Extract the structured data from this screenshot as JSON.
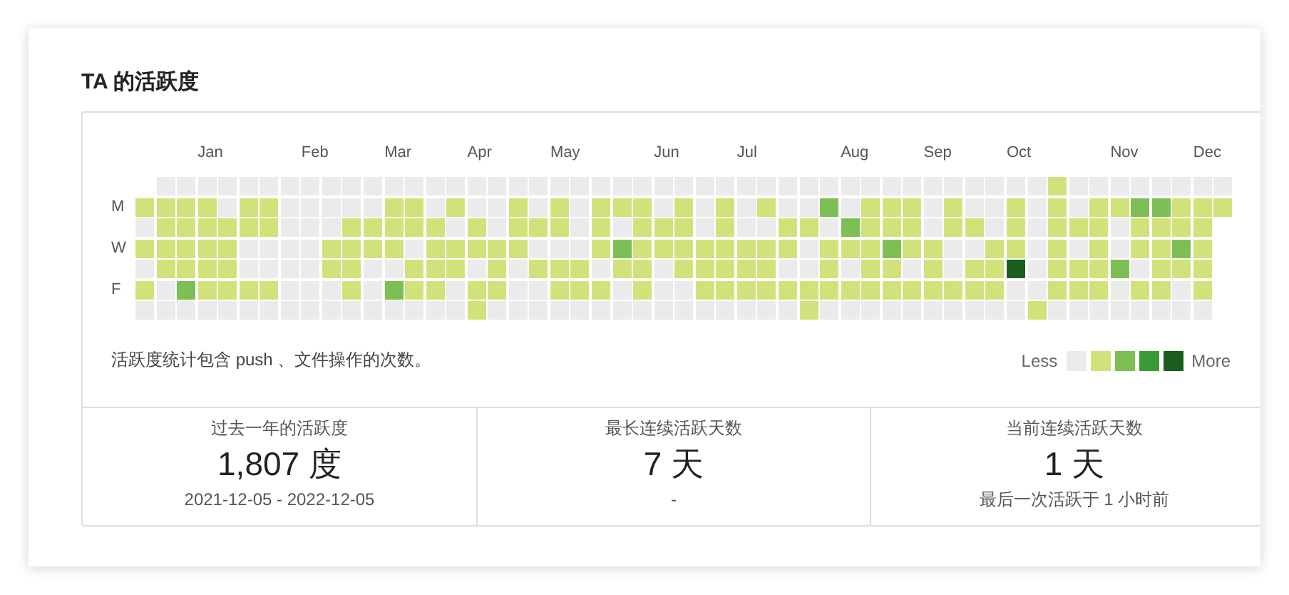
{
  "title": "TA 的活跃度",
  "day_labels": [
    "M",
    "W",
    "F"
  ],
  "weeks": [
    {
      "days": [
        {
          "color": "#d2e27a"
        },
        {
          "color": "#ebebeb"
        },
        {
          "color": "#d2e27a"
        },
        {
          "color": "#ebebeb"
        },
        {
          "color": "#d2e27a"
        },
        {
          "color": "#ebebeb"
        }
      ]
    },
    {
      "days": [
        {
          "color": "#ebebeb"
        },
        {
          "color": "#d2e27a"
        },
        {
          "color": "#d2e27a"
        },
        {
          "color": "#d2e27a"
        },
        {
          "color": "#d2e27a"
        },
        {
          "color": "#ebebeb"
        },
        {
          "color": "#ebebeb"
        }
      ]
    },
    {
      "days": [
        {
          "color": "#ebebeb"
        },
        {
          "color": "#d2e27a"
        },
        {
          "color": "#d2e27a"
        },
        {
          "color": "#d2e27a"
        },
        {
          "color": "#d2e27a"
        },
        {
          "color": "#7dbf55"
        },
        {
          "color": "#ebebeb"
        }
      ]
    },
    {
      "month": "Jan",
      "days": [
        {
          "color": "#ebebeb"
        },
        {
          "color": "#d2e27a"
        },
        {
          "color": "#d2e27a"
        },
        {
          "color": "#d2e27a"
        },
        {
          "color": "#d2e27a"
        },
        {
          "color": "#d2e27a"
        },
        {
          "color": "#ebebeb"
        }
      ]
    },
    {
      "days": [
        {
          "color": "#ebebeb"
        },
        {
          "color": "#ebebeb"
        },
        {
          "color": "#d2e27a"
        },
        {
          "color": "#d2e27a"
        },
        {
          "color": "#d2e27a"
        },
        {
          "color": "#d2e27a"
        },
        {
          "color": "#ebebeb"
        }
      ]
    },
    {
      "days": [
        {
          "color": "#ebebeb"
        },
        {
          "color": "#d2e27a"
        },
        {
          "color": "#d2e27a"
        },
        {
          "color": "#ebebeb"
        },
        {
          "color": "#ebebeb"
        },
        {
          "color": "#d2e27a"
        },
        {
          "color": "#ebebeb"
        }
      ]
    },
    {
      "days": [
        {
          "color": "#ebebeb"
        },
        {
          "color": "#d2e27a"
        },
        {
          "color": "#d2e27a"
        },
        {
          "color": "#ebebeb"
        },
        {
          "color": "#ebebeb"
        },
        {
          "color": "#d2e27a"
        },
        {
          "color": "#ebebeb"
        }
      ]
    },
    {
      "days": [
        {
          "color": "#ebebeb"
        },
        {
          "color": "#ebebeb"
        },
        {
          "color": "#ebebeb"
        },
        {
          "color": "#ebebeb"
        },
        {
          "color": "#ebebeb"
        },
        {
          "color": "#ebebeb"
        },
        {
          "color": "#ebebeb"
        }
      ]
    },
    {
      "month": "Feb",
      "days": [
        {
          "color": "#ebebeb"
        },
        {
          "color": "#ebebeb"
        },
        {
          "color": "#ebebeb"
        },
        {
          "color": "#ebebeb"
        },
        {
          "color": "#ebebeb"
        },
        {
          "color": "#ebebeb"
        },
        {
          "color": "#ebebeb"
        }
      ]
    },
    {
      "days": [
        {
          "color": "#ebebeb"
        },
        {
          "color": "#ebebeb"
        },
        {
          "color": "#ebebeb"
        },
        {
          "color": "#d2e27a"
        },
        {
          "color": "#d2e27a"
        },
        {
          "color": "#ebebeb"
        },
        {
          "color": "#ebebeb"
        }
      ]
    },
    {
      "days": [
        {
          "color": "#ebebeb"
        },
        {
          "color": "#ebebeb"
        },
        {
          "color": "#d2e27a"
        },
        {
          "color": "#d2e27a"
        },
        {
          "color": "#d2e27a"
        },
        {
          "color": "#d2e27a"
        },
        {
          "color": "#ebebeb"
        }
      ]
    },
    {
      "days": [
        {
          "color": "#ebebeb"
        },
        {
          "color": "#ebebeb"
        },
        {
          "color": "#d2e27a"
        },
        {
          "color": "#d2e27a"
        },
        {
          "color": "#ebebeb"
        },
        {
          "color": "#ebebeb"
        },
        {
          "color": "#ebebeb"
        }
      ]
    },
    {
      "month": "Mar",
      "days": [
        {
          "color": "#ebebeb"
        },
        {
          "color": "#d2e27a"
        },
        {
          "color": "#d2e27a"
        },
        {
          "color": "#d2e27a"
        },
        {
          "color": "#ebebeb"
        },
        {
          "color": "#7dbf55"
        },
        {
          "color": "#ebebeb"
        }
      ]
    },
    {
      "days": [
        {
          "color": "#ebebeb"
        },
        {
          "color": "#d2e27a"
        },
        {
          "color": "#d2e27a"
        },
        {
          "color": "#ebebeb"
        },
        {
          "color": "#d2e27a"
        },
        {
          "color": "#d2e27a"
        },
        {
          "color": "#ebebeb"
        }
      ]
    },
    {
      "days": [
        {
          "color": "#ebebeb"
        },
        {
          "color": "#ebebeb"
        },
        {
          "color": "#d2e27a"
        },
        {
          "color": "#d2e27a"
        },
        {
          "color": "#d2e27a"
        },
        {
          "color": "#d2e27a"
        },
        {
          "color": "#ebebeb"
        }
      ]
    },
    {
      "days": [
        {
          "color": "#ebebeb"
        },
        {
          "color": "#d2e27a"
        },
        {
          "color": "#ebebeb"
        },
        {
          "color": "#d2e27a"
        },
        {
          "color": "#d2e27a"
        },
        {
          "color": "#ebebeb"
        },
        {
          "color": "#ebebeb"
        }
      ]
    },
    {
      "month": "Apr",
      "days": [
        {
          "color": "#ebebeb"
        },
        {
          "color": "#ebebeb"
        },
        {
          "color": "#d2e27a"
        },
        {
          "color": "#d2e27a"
        },
        {
          "color": "#ebebeb"
        },
        {
          "color": "#d2e27a"
        },
        {
          "color": "#d2e27a"
        }
      ]
    },
    {
      "days": [
        {
          "color": "#ebebeb"
        },
        {
          "color": "#ebebeb"
        },
        {
          "color": "#ebebeb"
        },
        {
          "color": "#d2e27a"
        },
        {
          "color": "#d2e27a"
        },
        {
          "color": "#d2e27a"
        },
        {
          "color": "#ebebeb"
        }
      ]
    },
    {
      "days": [
        {
          "color": "#ebebeb"
        },
        {
          "color": "#d2e27a"
        },
        {
          "color": "#d2e27a"
        },
        {
          "color": "#d2e27a"
        },
        {
          "color": "#ebebeb"
        },
        {
          "color": "#ebebeb"
        },
        {
          "color": "#ebebeb"
        }
      ]
    },
    {
      "days": [
        {
          "color": "#ebebeb"
        },
        {
          "color": "#ebebeb"
        },
        {
          "color": "#d2e27a"
        },
        {
          "color": "#ebebeb"
        },
        {
          "color": "#d2e27a"
        },
        {
          "color": "#ebebeb"
        },
        {
          "color": "#ebebeb"
        }
      ]
    },
    {
      "month": "May",
      "days": [
        {
          "color": "#ebebeb"
        },
        {
          "color": "#d2e27a"
        },
        {
          "color": "#d2e27a"
        },
        {
          "color": "#ebebeb"
        },
        {
          "color": "#d2e27a"
        },
        {
          "color": "#d2e27a"
        },
        {
          "color": "#ebebeb"
        }
      ]
    },
    {
      "days": [
        {
          "color": "#ebebeb"
        },
        {
          "color": "#ebebeb"
        },
        {
          "color": "#ebebeb"
        },
        {
          "color": "#ebebeb"
        },
        {
          "color": "#d2e27a"
        },
        {
          "color": "#d2e27a"
        },
        {
          "color": "#ebebeb"
        }
      ]
    },
    {
      "days": [
        {
          "color": "#ebebeb"
        },
        {
          "color": "#d2e27a"
        },
        {
          "color": "#d2e27a"
        },
        {
          "color": "#d2e27a"
        },
        {
          "color": "#ebebeb"
        },
        {
          "color": "#d2e27a"
        },
        {
          "color": "#ebebeb"
        }
      ]
    },
    {
      "days": [
        {
          "color": "#ebebeb"
        },
        {
          "color": "#d2e27a"
        },
        {
          "color": "#ebebeb"
        },
        {
          "color": "#7dbf55"
        },
        {
          "color": "#d2e27a"
        },
        {
          "color": "#ebebeb"
        },
        {
          "color": "#ebebeb"
        }
      ]
    },
    {
      "days": [
        {
          "color": "#ebebeb"
        },
        {
          "color": "#d2e27a"
        },
        {
          "color": "#d2e27a"
        },
        {
          "color": "#d2e27a"
        },
        {
          "color": "#d2e27a"
        },
        {
          "color": "#d2e27a"
        },
        {
          "color": "#ebebeb"
        }
      ]
    },
    {
      "month": "Jun",
      "days": [
        {
          "color": "#ebebeb"
        },
        {
          "color": "#ebebeb"
        },
        {
          "color": "#d2e27a"
        },
        {
          "color": "#d2e27a"
        },
        {
          "color": "#ebebeb"
        },
        {
          "color": "#ebebeb"
        },
        {
          "color": "#ebebeb"
        }
      ]
    },
    {
      "days": [
        {
          "color": "#ebebeb"
        },
        {
          "color": "#d2e27a"
        },
        {
          "color": "#d2e27a"
        },
        {
          "color": "#d2e27a"
        },
        {
          "color": "#d2e27a"
        },
        {
          "color": "#ebebeb"
        },
        {
          "color": "#ebebeb"
        }
      ]
    },
    {
      "days": [
        {
          "color": "#ebebeb"
        },
        {
          "color": "#ebebeb"
        },
        {
          "color": "#ebebeb"
        },
        {
          "color": "#d2e27a"
        },
        {
          "color": "#d2e27a"
        },
        {
          "color": "#d2e27a"
        },
        {
          "color": "#ebebeb"
        }
      ]
    },
    {
      "days": [
        {
          "color": "#ebebeb"
        },
        {
          "color": "#d2e27a"
        },
        {
          "color": "#d2e27a"
        },
        {
          "color": "#d2e27a"
        },
        {
          "color": "#d2e27a"
        },
        {
          "color": "#d2e27a"
        },
        {
          "color": "#ebebeb"
        }
      ]
    },
    {
      "month": "Jul",
      "days": [
        {
          "color": "#ebebeb"
        },
        {
          "color": "#ebebeb"
        },
        {
          "color": "#ebebeb"
        },
        {
          "color": "#d2e27a"
        },
        {
          "color": "#d2e27a"
        },
        {
          "color": "#d2e27a"
        },
        {
          "color": "#ebebeb"
        }
      ]
    },
    {
      "days": [
        {
          "color": "#ebebeb"
        },
        {
          "color": "#d2e27a"
        },
        {
          "color": "#ebebeb"
        },
        {
          "color": "#d2e27a"
        },
        {
          "color": "#d2e27a"
        },
        {
          "color": "#d2e27a"
        },
        {
          "color": "#ebebeb"
        }
      ]
    },
    {
      "days": [
        {
          "color": "#ebebeb"
        },
        {
          "color": "#ebebeb"
        },
        {
          "color": "#d2e27a"
        },
        {
          "color": "#d2e27a"
        },
        {
          "color": "#ebebeb"
        },
        {
          "color": "#d2e27a"
        },
        {
          "color": "#ebebeb"
        }
      ]
    },
    {
      "days": [
        {
          "color": "#ebebeb"
        },
        {
          "color": "#ebebeb"
        },
        {
          "color": "#d2e27a"
        },
        {
          "color": "#ebebeb"
        },
        {
          "color": "#ebebeb"
        },
        {
          "color": "#d2e27a"
        },
        {
          "color": "#d2e27a"
        }
      ]
    },
    {
      "days": [
        {
          "color": "#ebebeb"
        },
        {
          "color": "#7dbf55"
        },
        {
          "color": "#ebebeb"
        },
        {
          "color": "#d2e27a"
        },
        {
          "color": "#d2e27a"
        },
        {
          "color": "#d2e27a"
        },
        {
          "color": "#ebebeb"
        }
      ]
    },
    {
      "month": "Aug",
      "days": [
        {
          "color": "#ebebeb"
        },
        {
          "color": "#ebebeb"
        },
        {
          "color": "#7dbf55"
        },
        {
          "color": "#d2e27a"
        },
        {
          "color": "#ebebeb"
        },
        {
          "color": "#d2e27a"
        },
        {
          "color": "#ebebeb"
        }
      ]
    },
    {
      "days": [
        {
          "color": "#ebebeb"
        },
        {
          "color": "#d2e27a"
        },
        {
          "color": "#d2e27a"
        },
        {
          "color": "#d2e27a"
        },
        {
          "color": "#d2e27a"
        },
        {
          "color": "#d2e27a"
        },
        {
          "color": "#ebebeb"
        }
      ]
    },
    {
      "days": [
        {
          "color": "#ebebeb"
        },
        {
          "color": "#d2e27a"
        },
        {
          "color": "#d2e27a"
        },
        {
          "color": "#7dbf55"
        },
        {
          "color": "#d2e27a"
        },
        {
          "color": "#d2e27a"
        },
        {
          "color": "#ebebeb"
        }
      ]
    },
    {
      "days": [
        {
          "color": "#ebebeb"
        },
        {
          "color": "#d2e27a"
        },
        {
          "color": "#d2e27a"
        },
        {
          "color": "#d2e27a"
        },
        {
          "color": "#ebebeb"
        },
        {
          "color": "#d2e27a"
        },
        {
          "color": "#ebebeb"
        }
      ]
    },
    {
      "month": "Sep",
      "days": [
        {
          "color": "#ebebeb"
        },
        {
          "color": "#ebebeb"
        },
        {
          "color": "#ebebeb"
        },
        {
          "color": "#d2e27a"
        },
        {
          "color": "#d2e27a"
        },
        {
          "color": "#d2e27a"
        },
        {
          "color": "#ebebeb"
        }
      ]
    },
    {
      "days": [
        {
          "color": "#ebebeb"
        },
        {
          "color": "#d2e27a"
        },
        {
          "color": "#d2e27a"
        },
        {
          "color": "#ebebeb"
        },
        {
          "color": "#ebebeb"
        },
        {
          "color": "#d2e27a"
        },
        {
          "color": "#ebebeb"
        }
      ]
    },
    {
      "days": [
        {
          "color": "#ebebeb"
        },
        {
          "color": "#ebebeb"
        },
        {
          "color": "#d2e27a"
        },
        {
          "color": "#ebebeb"
        },
        {
          "color": "#d2e27a"
        },
        {
          "color": "#d2e27a"
        },
        {
          "color": "#ebebeb"
        }
      ]
    },
    {
      "days": [
        {
          "color": "#ebebeb"
        },
        {
          "color": "#ebebeb"
        },
        {
          "color": "#ebebeb"
        },
        {
          "color": "#d2e27a"
        },
        {
          "color": "#d2e27a"
        },
        {
          "color": "#d2e27a"
        },
        {
          "color": "#ebebeb"
        }
      ]
    },
    {
      "month": "Oct",
      "days": [
        {
          "color": "#ebebeb"
        },
        {
          "color": "#d2e27a"
        },
        {
          "color": "#d2e27a"
        },
        {
          "color": "#d2e27a"
        },
        {
          "color": "#1b5e20"
        },
        {
          "color": "#ebebeb"
        },
        {
          "color": "#ebebeb"
        }
      ]
    },
    {
      "days": [
        {
          "color": "#ebebeb"
        },
        {
          "color": "#ebebeb"
        },
        {
          "color": "#ebebeb"
        },
        {
          "color": "#ebebeb"
        },
        {
          "color": "#ebebeb"
        },
        {
          "color": "#ebebeb"
        },
        {
          "color": "#d2e27a"
        }
      ]
    },
    {
      "days": [
        {
          "color": "#d2e27a"
        },
        {
          "color": "#d2e27a"
        },
        {
          "color": "#d2e27a"
        },
        {
          "color": "#d2e27a"
        },
        {
          "color": "#d2e27a"
        },
        {
          "color": "#d2e27a"
        },
        {
          "color": "#ebebeb"
        }
      ]
    },
    {
      "days": [
        {
          "color": "#ebebeb"
        },
        {
          "color": "#ebebeb"
        },
        {
          "color": "#d2e27a"
        },
        {
          "color": "#ebebeb"
        },
        {
          "color": "#d2e27a"
        },
        {
          "color": "#d2e27a"
        },
        {
          "color": "#ebebeb"
        }
      ]
    },
    {
      "days": [
        {
          "color": "#ebebeb"
        },
        {
          "color": "#d2e27a"
        },
        {
          "color": "#d2e27a"
        },
        {
          "color": "#d2e27a"
        },
        {
          "color": "#d2e27a"
        },
        {
          "color": "#d2e27a"
        },
        {
          "color": "#ebebeb"
        }
      ]
    },
    {
      "month": "Nov",
      "days": [
        {
          "color": "#ebebeb"
        },
        {
          "color": "#d2e27a"
        },
        {
          "color": "#ebebeb"
        },
        {
          "color": "#ebebeb"
        },
        {
          "color": "#7dbf55"
        },
        {
          "color": "#ebebeb"
        },
        {
          "color": "#ebebeb"
        }
      ]
    },
    {
      "days": [
        {
          "color": "#ebebeb"
        },
        {
          "color": "#7dbf55"
        },
        {
          "color": "#d2e27a"
        },
        {
          "color": "#d2e27a"
        },
        {
          "color": "#ebebeb"
        },
        {
          "color": "#d2e27a"
        },
        {
          "color": "#ebebeb"
        }
      ]
    },
    {
      "days": [
        {
          "color": "#ebebeb"
        },
        {
          "color": "#7dbf55"
        },
        {
          "color": "#d2e27a"
        },
        {
          "color": "#d2e27a"
        },
        {
          "color": "#d2e27a"
        },
        {
          "color": "#d2e27a"
        },
        {
          "color": "#ebebeb"
        }
      ]
    },
    {
      "days": [
        {
          "color": "#ebebeb"
        },
        {
          "color": "#d2e27a"
        },
        {
          "color": "#d2e27a"
        },
        {
          "color": "#7dbf55"
        },
        {
          "color": "#d2e27a"
        },
        {
          "color": "#ebebeb"
        },
        {
          "color": "#ebebeb"
        }
      ]
    },
    {
      "month": "Dec",
      "days": [
        {
          "color": "#ebebeb"
        },
        {
          "color": "#d2e27a"
        },
        {
          "color": "#d2e27a"
        },
        {
          "color": "#d2e27a"
        },
        {
          "color": "#d2e27a"
        },
        {
          "color": "#d2e27a"
        },
        {
          "color": "#ebebeb"
        }
      ]
    },
    {
      "days": [
        {
          "color": "#ebebeb"
        },
        {
          "color": "#d2e27a"
        }
      ]
    }
  ],
  "note": "活跃度统计包含 push 、文件操作的次数。",
  "legend": {
    "less": "Less",
    "more": "More",
    "levels": [
      {
        "color": "#ebebeb"
      },
      {
        "color": "#d2e27a"
      },
      {
        "color": "#7dbf55"
      },
      {
        "color": "#3c9a36"
      },
      {
        "color": "#1b5e20"
      }
    ]
  },
  "stats": [
    {
      "label": "过去一年的活跃度",
      "value": "1,807 度",
      "sub": "2021-12-05 - 2022-12-05"
    },
    {
      "label": "最长连续活跃天数",
      "value": "7 天",
      "sub": "-"
    },
    {
      "label": "当前连续活跃天数",
      "value": "1 天",
      "sub": "最后一次活跃于 1 小时前"
    }
  ]
}
